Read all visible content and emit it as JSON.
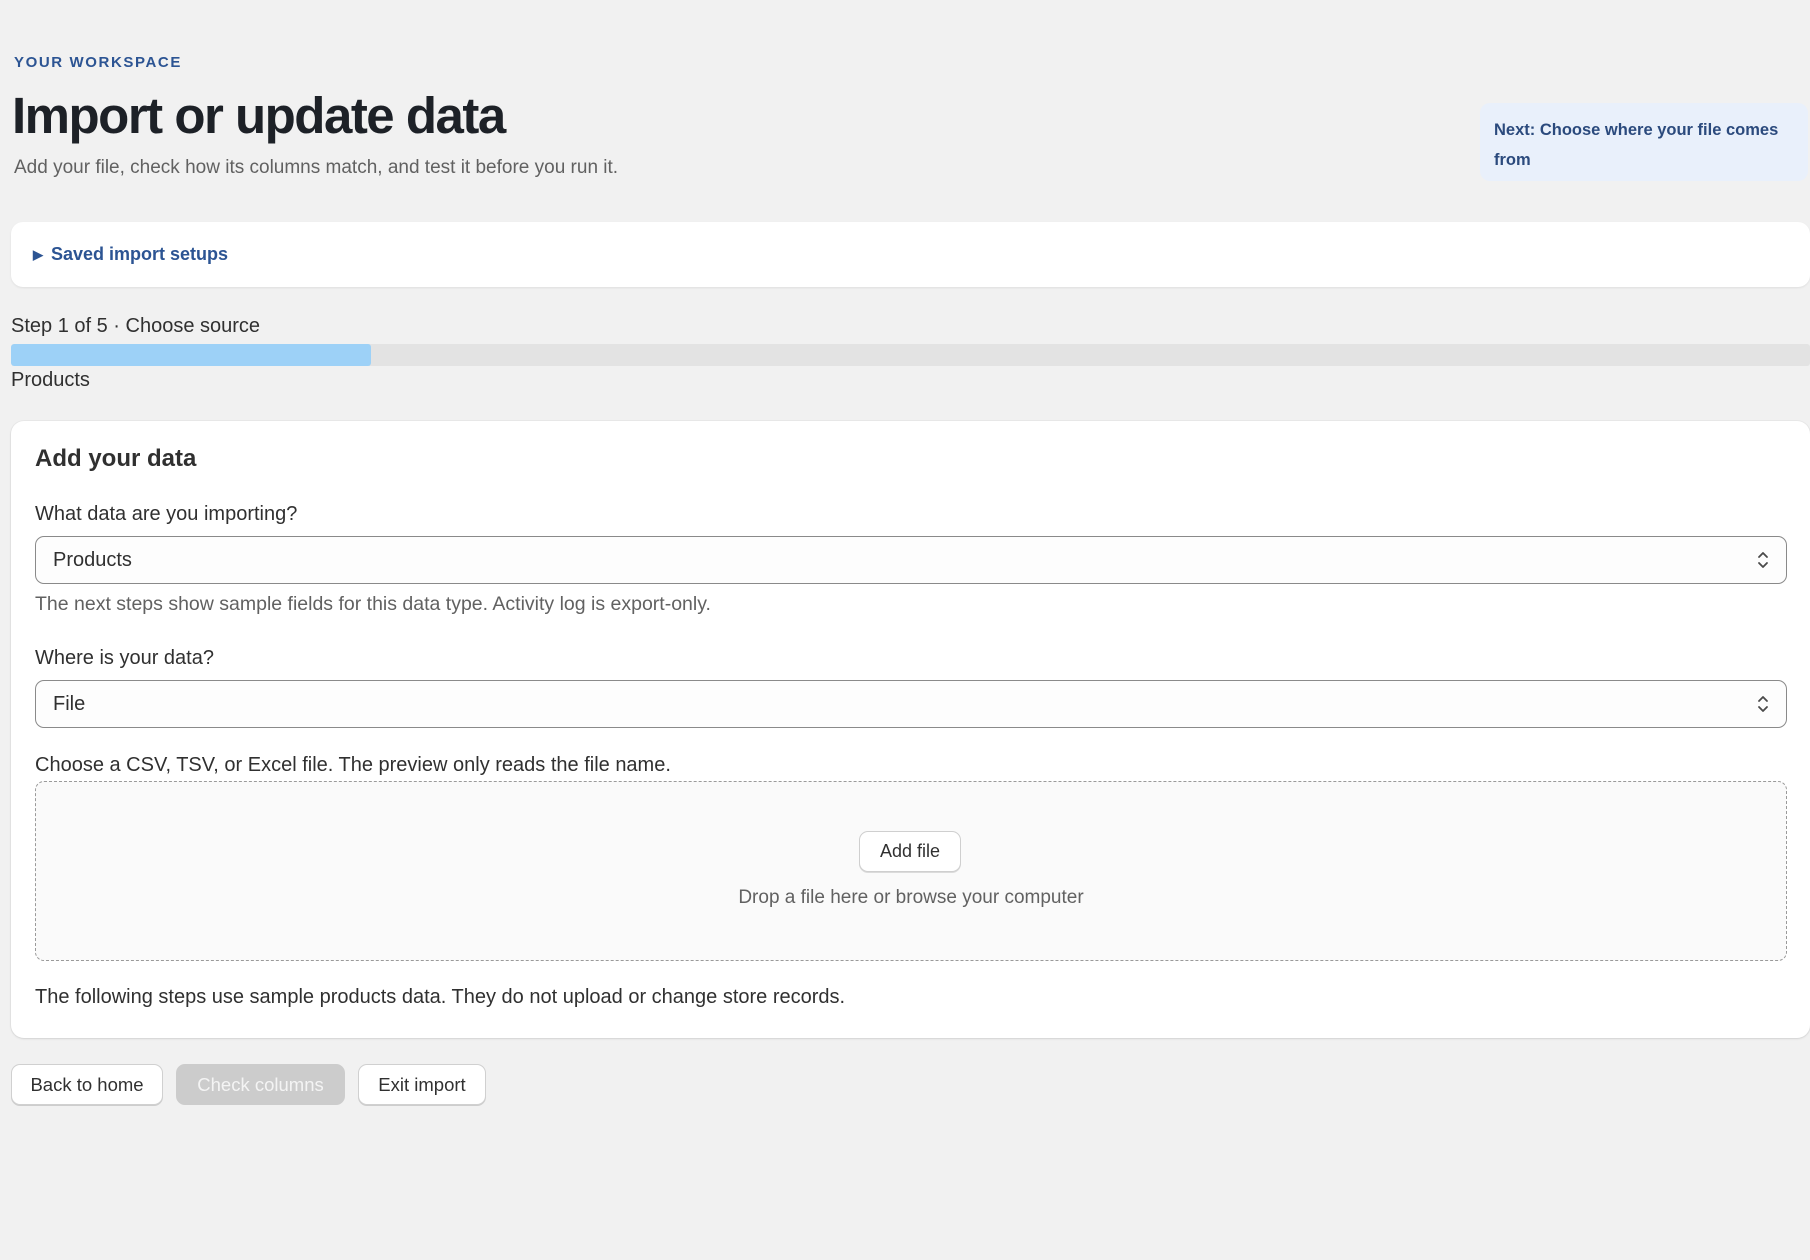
{
  "header": {
    "eyebrow": "YOUR WORKSPACE",
    "title": "Import or update data",
    "subtitle": "Add your file, check how its columns match, and test it before you run it.",
    "next_hint": "Next: Choose where your file comes from"
  },
  "saved_setups": {
    "caret_icon": "▶",
    "label": "Saved import setups"
  },
  "progress": {
    "step_label": "Step 1 of 5 · Choose source",
    "fraction": 0.2,
    "caption": "Products",
    "fill_color": "#9dd1f7"
  },
  "card": {
    "title": "Add your data",
    "data_type": {
      "label": "What data are you importing?",
      "selected": "Products",
      "help": "The next steps show sample fields for this data type. Activity log is export-only."
    },
    "source": {
      "label": "Where is your data?",
      "selected": "File"
    },
    "file_help": "Choose a CSV, TSV, or Excel file. The preview only reads the file name.",
    "dropzone": {
      "button_label": "Add file",
      "hint": "Drop a file here or browse your computer"
    },
    "footnote": "The following steps use sample products data. They do not upload or change store records."
  },
  "actions": {
    "back_label": "Back to home",
    "check_label": "Check columns",
    "exit_label": "Exit import"
  },
  "colors": {
    "accent": "#2c5493",
    "hint_background": "#e9f0fb",
    "page_background": "#f1f1f1"
  }
}
